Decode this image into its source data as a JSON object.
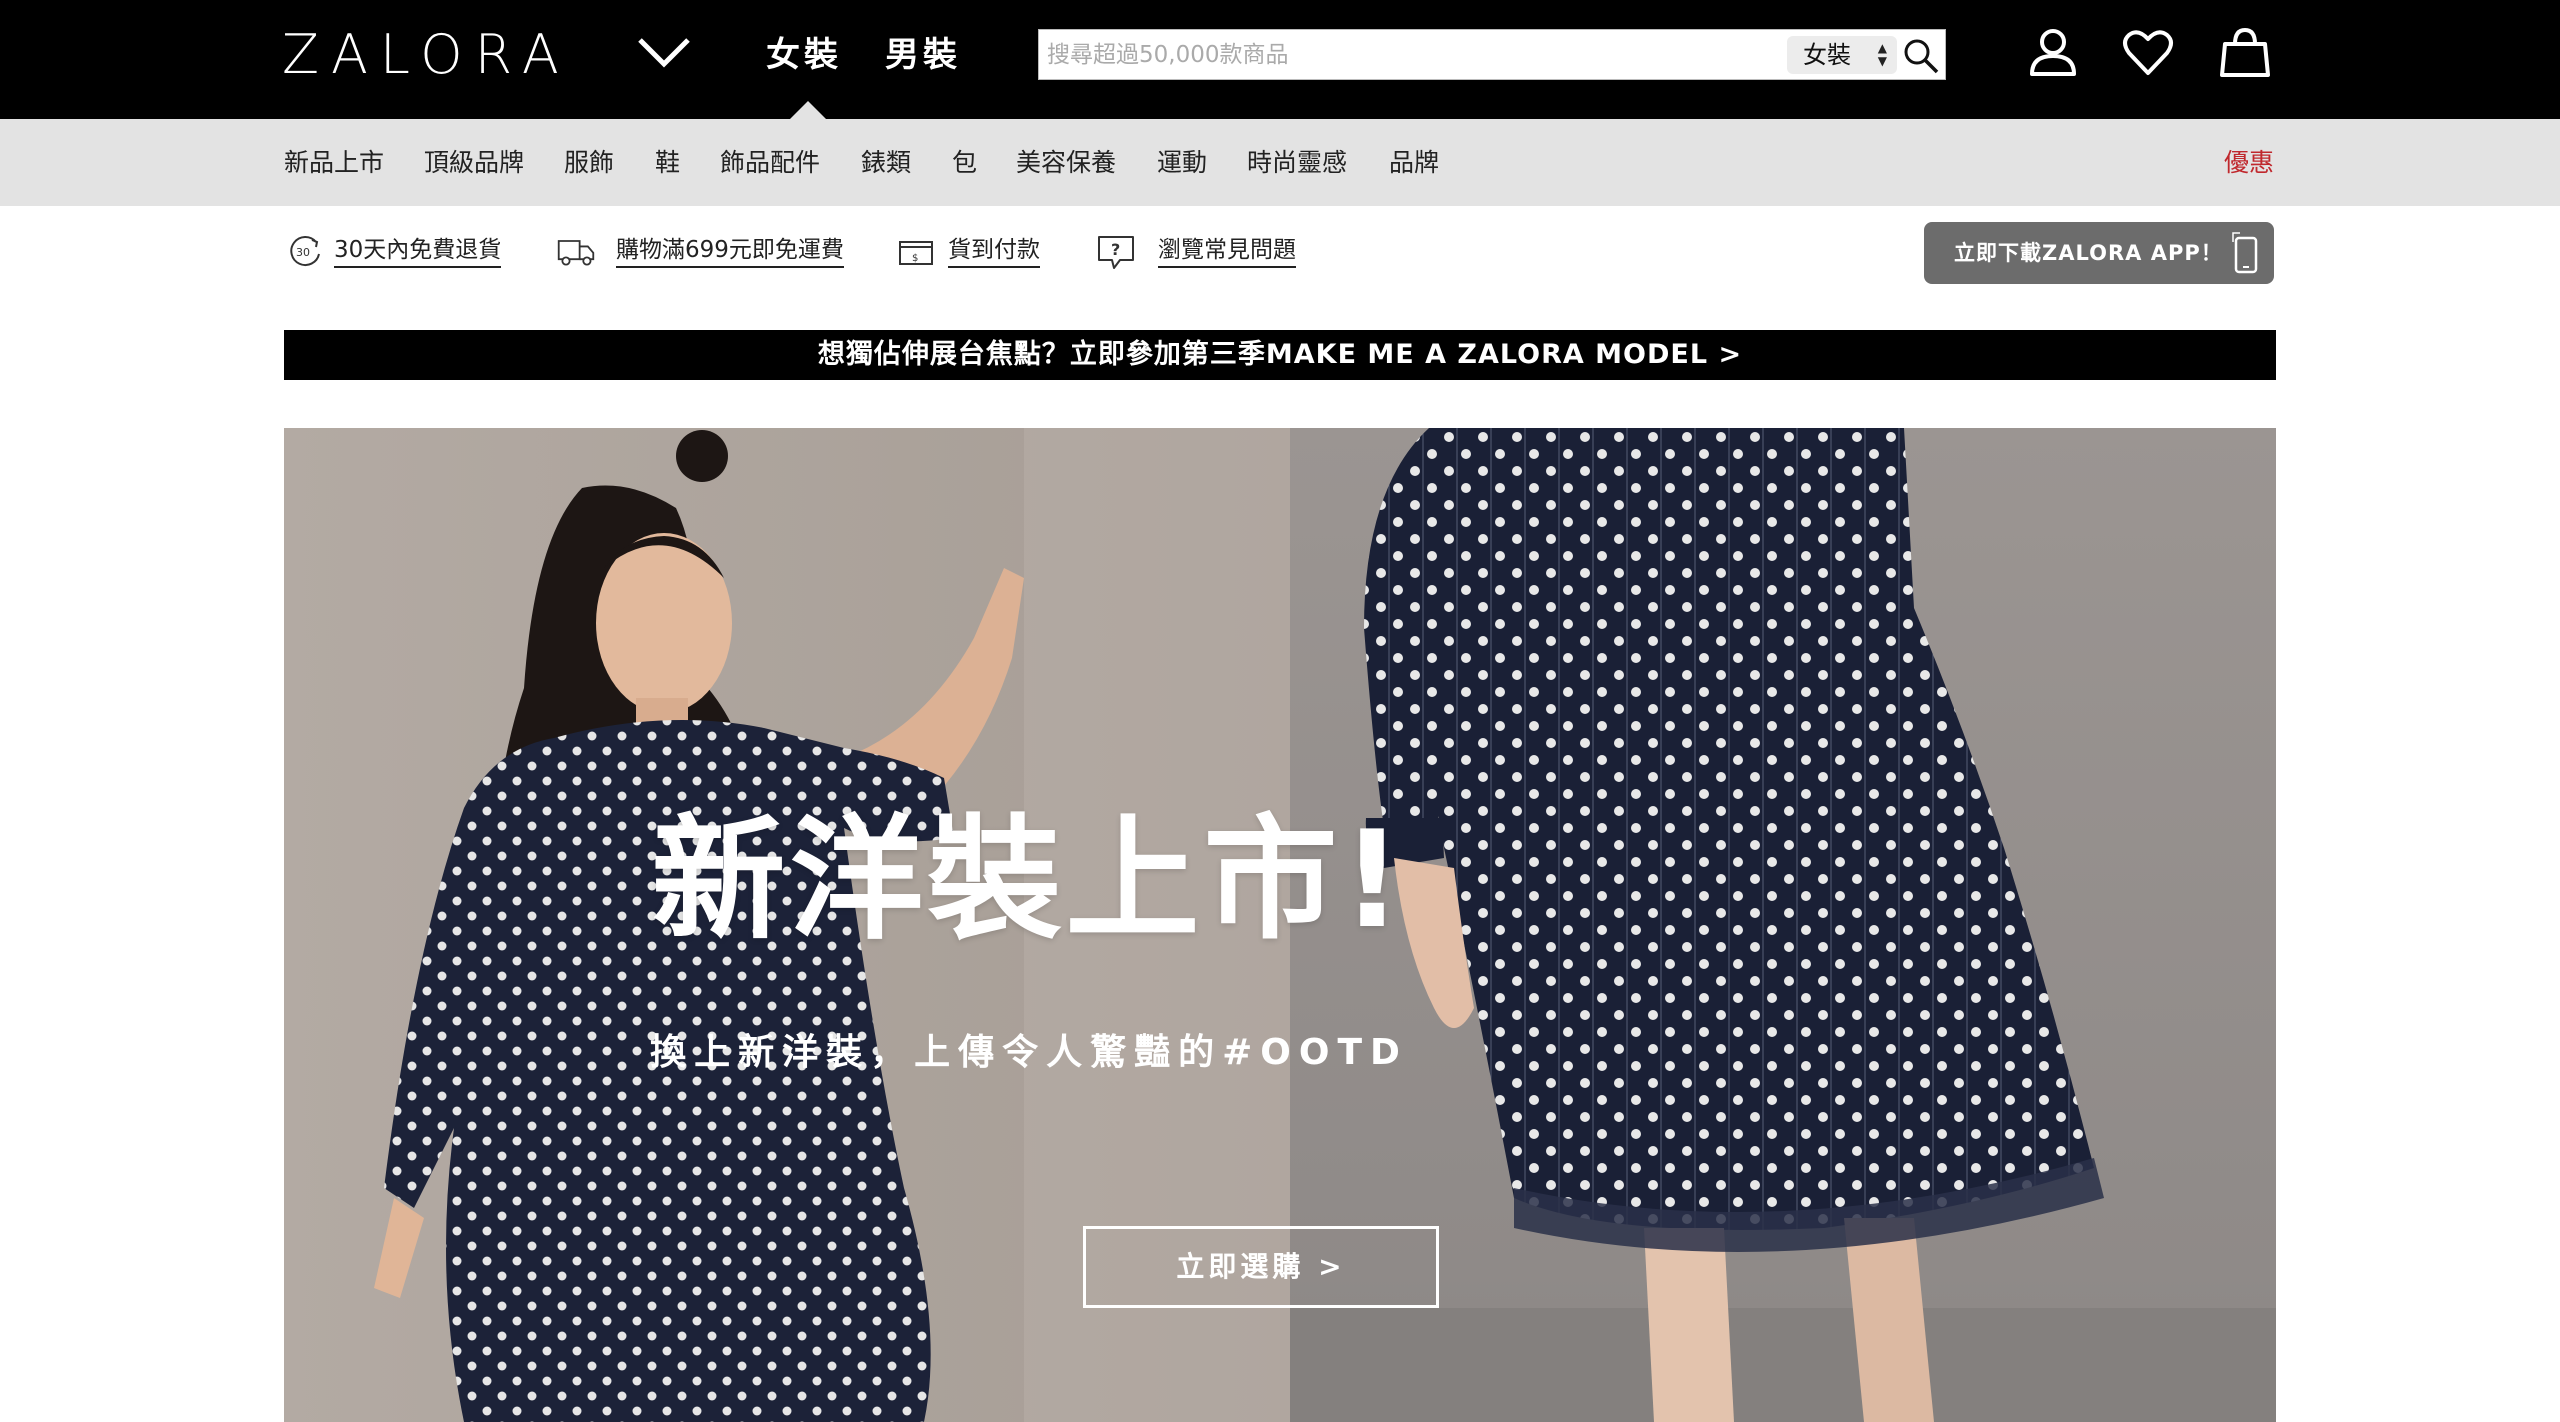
{
  "header": {
    "logo": "ZALORA",
    "tabs": [
      {
        "label": "女裝",
        "active": true
      },
      {
        "label": "男裝",
        "active": false
      }
    ],
    "search": {
      "placeholder": "搜尋超過50,000款商品",
      "value": "",
      "category_selected": "女裝"
    },
    "icons": [
      "user-icon",
      "heart-icon",
      "shopping-bag-icon"
    ]
  },
  "categories": {
    "items": [
      "新品上市",
      "頂級品牌",
      "服飾",
      "鞋",
      "飾品配件",
      "錶類",
      "包",
      "美容保養",
      "運動",
      "時尚靈感",
      "品牌"
    ],
    "promo": "優惠",
    "promo_color": "#c0282d"
  },
  "usp": {
    "items": [
      {
        "icon": "30-day-return-icon",
        "label": "30天內免費退貨"
      },
      {
        "icon": "delivery-truck-icon",
        "label": "購物滿699元即免運費"
      },
      {
        "icon": "cash-on-delivery-icon",
        "label": "貨到付款"
      },
      {
        "icon": "faq-icon",
        "label": "瀏覽常見問題"
      }
    ],
    "app_button": "立即下載ZALORA APP！",
    "icon_30": "30"
  },
  "announcement": "想獨佔伸展台焦點？立即參加第三季MAKE ME A ZALORA MODEL >",
  "hero": {
    "title": "新洋裝上市!",
    "subtitle": "換上新洋裝，上傳令人驚豔的#OOTD",
    "cta": "立即選購 >"
  },
  "colors": {
    "topbar": "#000000",
    "category_bar": "#e3e3e3",
    "app_button": "#6c6c6c",
    "dress_navy": "#1c2238"
  }
}
